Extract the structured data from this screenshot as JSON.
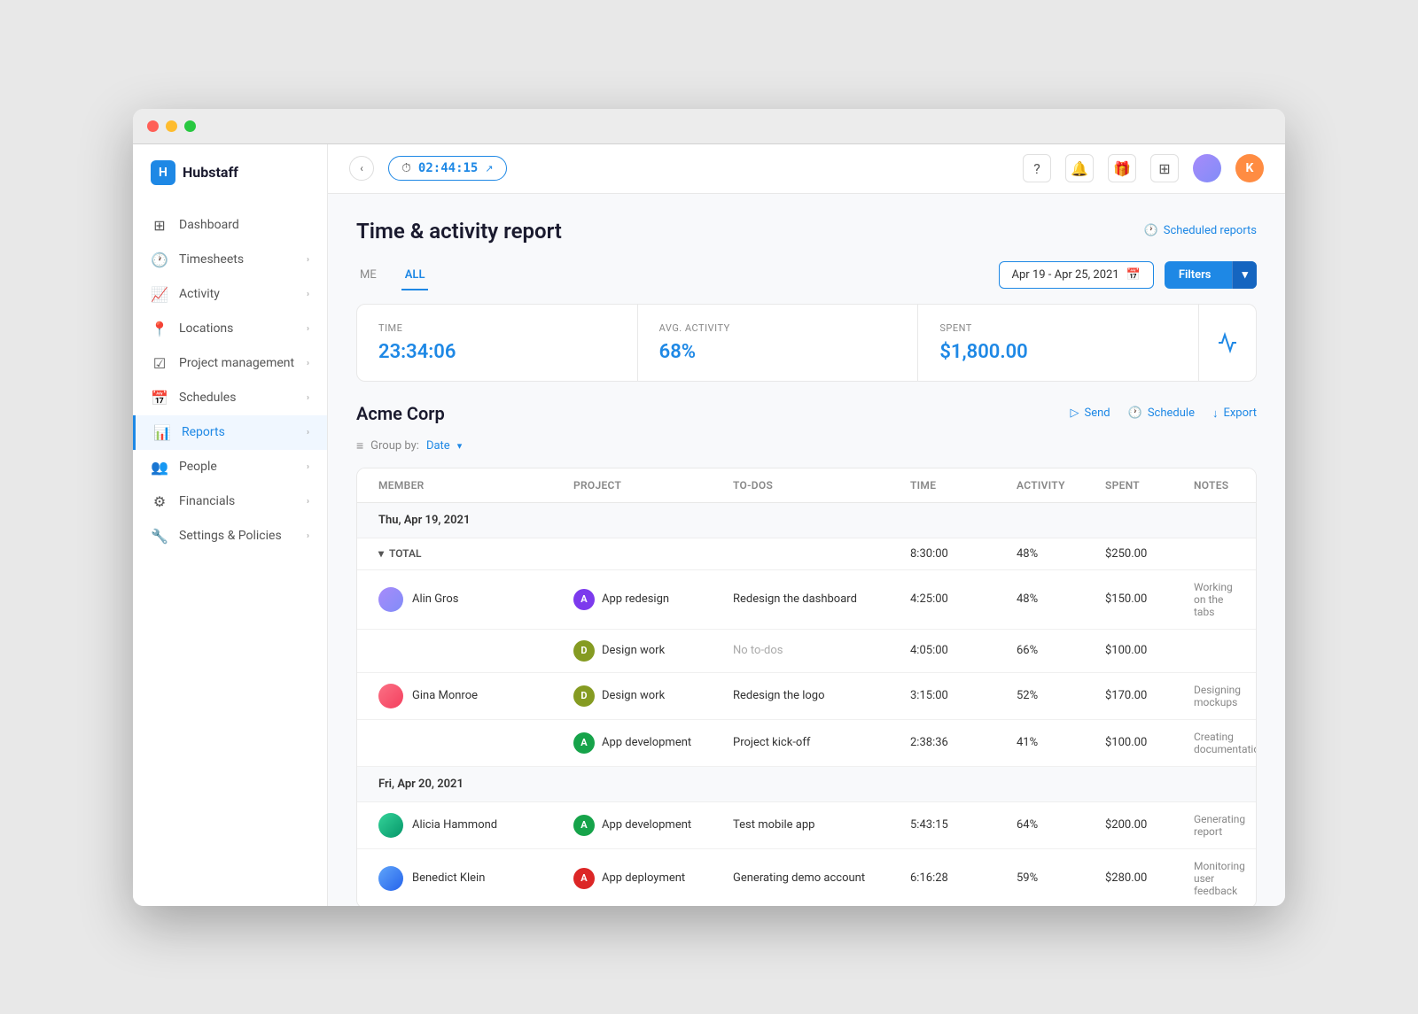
{
  "window": {
    "title": "Hubstaff"
  },
  "topbar": {
    "timer": "02:44:15",
    "avatar_k": "K"
  },
  "sidebar": {
    "logo": "Hubstaff",
    "items": [
      {
        "id": "dashboard",
        "label": "Dashboard",
        "icon": "⊞"
      },
      {
        "id": "timesheets",
        "label": "Timesheets",
        "icon": "🕐",
        "hasChevron": true
      },
      {
        "id": "activity",
        "label": "Activity",
        "icon": "📈",
        "hasChevron": true
      },
      {
        "id": "locations",
        "label": "Locations",
        "icon": "📍",
        "hasChevron": true
      },
      {
        "id": "project-management",
        "label": "Project management",
        "icon": "☑",
        "hasChevron": true
      },
      {
        "id": "schedules",
        "label": "Schedules",
        "icon": "📅",
        "hasChevron": true
      },
      {
        "id": "reports",
        "label": "Reports",
        "icon": "📊",
        "hasChevron": true,
        "active": true
      },
      {
        "id": "people",
        "label": "People",
        "icon": "👥",
        "hasChevron": true
      },
      {
        "id": "financials",
        "label": "Financials",
        "icon": "⚙",
        "hasChevron": true
      },
      {
        "id": "settings-policies",
        "label": "Settings & Policies",
        "icon": "🔧",
        "hasChevron": true
      }
    ]
  },
  "page": {
    "title": "Time & activity report",
    "scheduled_reports": "Scheduled reports",
    "tabs": [
      {
        "id": "me",
        "label": "ME"
      },
      {
        "id": "all",
        "label": "ALL",
        "active": true
      }
    ],
    "date_range": "Apr 19 - Apr 25, 2021",
    "filters_btn": "Filters"
  },
  "stats": {
    "time_label": "TIME",
    "time_value": "23:34:06",
    "avg_activity_label": "AVG. ACTIVITY",
    "avg_activity_value": "68%",
    "spent_label": "SPENT",
    "spent_value": "$1,800.00"
  },
  "section": {
    "title": "Acme Corp",
    "send_label": "Send",
    "schedule_label": "Schedule",
    "export_label": "Export",
    "groupby_label": "Group by:",
    "groupby_value": "Date"
  },
  "table": {
    "columns": [
      "Member",
      "Project",
      "To-dos",
      "Time",
      "Activity",
      "Spent",
      "Notes"
    ],
    "groups": [
      {
        "date": "Thu, Apr 19, 2021",
        "total": {
          "time": "8:30:00",
          "activity": "48%",
          "spent": "$250.00"
        },
        "rows": [
          {
            "member": "Alin Gros",
            "avatar": "alin",
            "project": "App redesign",
            "project_badge": "A",
            "badge_color": "badge-purple",
            "todo": "Redesign the dashboard",
            "time": "4:25:00",
            "activity": "48%",
            "spent": "$150.00",
            "notes": "Working on the tabs"
          },
          {
            "member": "",
            "avatar": "",
            "project": "Design work",
            "project_badge": "D",
            "badge_color": "badge-olive",
            "todo": "No to-dos",
            "todo_none": true,
            "time": "4:05:00",
            "activity": "66%",
            "spent": "$100.00",
            "notes": ""
          },
          {
            "member": "Gina Monroe",
            "avatar": "gina",
            "project": "Design work",
            "project_badge": "D",
            "badge_color": "badge-olive",
            "todo": "Redesign the logo",
            "time": "3:15:00",
            "activity": "52%",
            "spent": "$170.00",
            "notes": "Designing mockups"
          },
          {
            "member": "",
            "avatar": "",
            "project": "App development",
            "project_badge": "A",
            "badge_color": "badge-green",
            "todo": "Project kick-off",
            "time": "2:38:36",
            "activity": "41%",
            "spent": "$100.00",
            "notes": "Creating documentation"
          }
        ]
      },
      {
        "date": "Fri, Apr 20, 2021",
        "rows": [
          {
            "member": "Alicia Hammond",
            "avatar": "alicia",
            "project": "App development",
            "project_badge": "A",
            "badge_color": "badge-green",
            "todo": "Test mobile app",
            "time": "5:43:15",
            "activity": "64%",
            "spent": "$200.00",
            "notes": "Generating report"
          },
          {
            "member": "Benedict Klein",
            "avatar": "benedict",
            "project": "App deployment",
            "project_badge": "A",
            "badge_color": "badge-red",
            "todo": "Generating demo account",
            "time": "6:16:28",
            "activity": "59%",
            "spent": "$280.00",
            "notes": "Monitoring user feedback"
          }
        ]
      }
    ]
  }
}
